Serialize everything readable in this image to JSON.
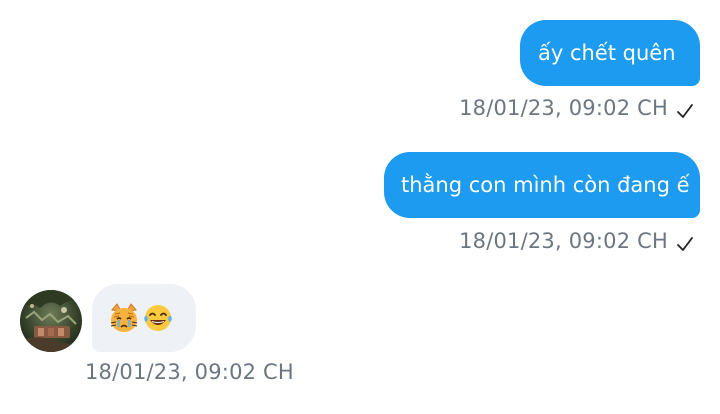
{
  "messages": [
    {
      "direction": "outgoing",
      "text": "ấy chết quên",
      "timestamp": "18/01/23,  09:02 CH",
      "status": "sent"
    },
    {
      "direction": "outgoing",
      "text": "thằng con mình còn đang ế",
      "timestamp": "18/01/23,  09:02 CH",
      "status": "sent"
    },
    {
      "direction": "incoming",
      "emojis": [
        "crying-cat-face-icon",
        "laughing-tears-face-icon"
      ],
      "timestamp": "18/01/23,  09:02 CH"
    }
  ],
  "colors": {
    "outgoing_bubble": "#1d9bf0",
    "incoming_bubble": "#eef1f5",
    "timestamp_text": "#6b7683"
  }
}
